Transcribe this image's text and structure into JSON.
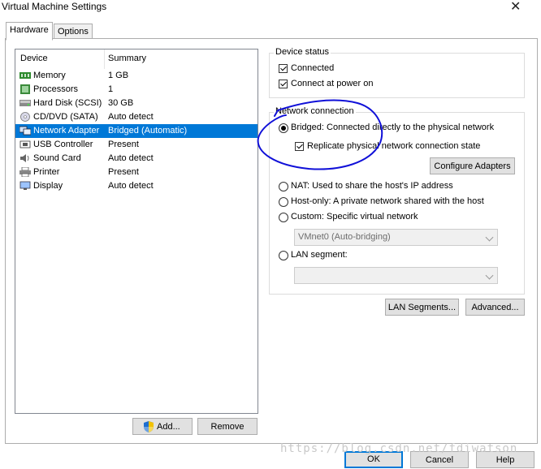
{
  "window": {
    "title": "Virtual Machine Settings",
    "close_glyph": "✕"
  },
  "tabs": [
    {
      "label": "Hardware",
      "active": true
    },
    {
      "label": "Options",
      "active": false
    }
  ],
  "device_list": {
    "headers": {
      "device": "Device",
      "summary": "Summary"
    },
    "rows": [
      {
        "name": "Memory",
        "summary": "1 GB",
        "icon": "memory-icon"
      },
      {
        "name": "Processors",
        "summary": "1",
        "icon": "processor-icon"
      },
      {
        "name": "Hard Disk (SCSI)",
        "summary": "30 GB",
        "icon": "hard-disk-icon"
      },
      {
        "name": "CD/DVD (SATA)",
        "summary": "Auto detect",
        "icon": "cd-dvd-icon"
      },
      {
        "name": "Network Adapter",
        "summary": "Bridged (Automatic)",
        "icon": "network-adapter-icon",
        "selected": true
      },
      {
        "name": "USB Controller",
        "summary": "Present",
        "icon": "usb-icon"
      },
      {
        "name": "Sound Card",
        "summary": "Auto detect",
        "icon": "sound-card-icon"
      },
      {
        "name": "Printer",
        "summary": "Present",
        "icon": "printer-icon"
      },
      {
        "name": "Display",
        "summary": "Auto detect",
        "icon": "display-icon"
      }
    ]
  },
  "buttons": {
    "add": "Add...",
    "remove": "Remove",
    "configure_adapters": "Configure Adapters",
    "lan_segments": "LAN Segments...",
    "advanced": "Advanced...",
    "ok": "OK",
    "cancel": "Cancel",
    "help": "Help"
  },
  "device_status": {
    "title": "Device status",
    "connected": "Connected",
    "connect_at_power_on": "Connect at power on"
  },
  "network_connection": {
    "title": "Network connection",
    "bridged": "Bridged: Connected directly to the physical network",
    "replicate": "Replicate physical network connection state",
    "nat": "NAT: Used to share the host's IP address",
    "host_only": "Host-only: A private network shared with the host",
    "custom": "Custom: Specific virtual network",
    "custom_value": "VMnet0 (Auto-bridging)",
    "lan_segment": "LAN segment:",
    "lan_value": ""
  },
  "colors": {
    "accent": "#0078d7",
    "annotation": "#1010d8"
  },
  "watermark": "https://blog.csdn.net/fdiwatson"
}
